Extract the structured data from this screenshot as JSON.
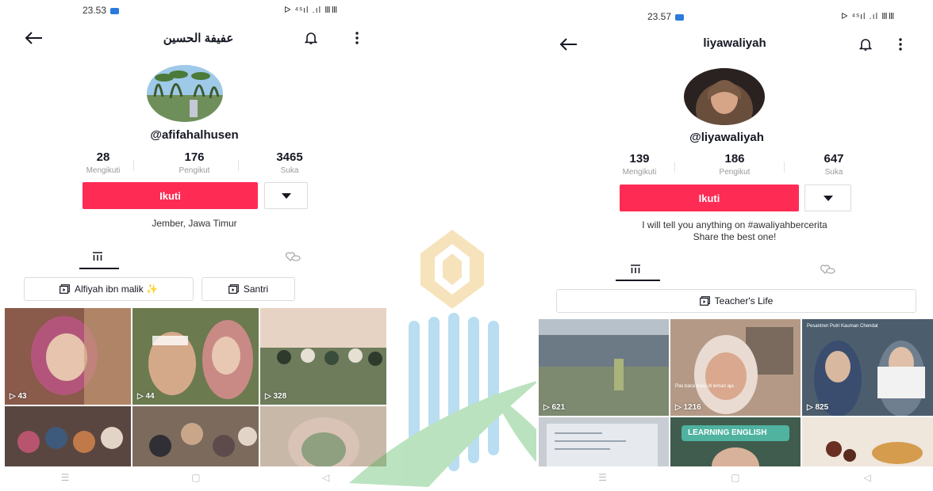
{
  "left": {
    "status_time": "23.53",
    "status_right": "ᐅ ⁴ˢıl .ıl ⅢⅢ",
    "title": "عفيفة الحسين",
    "handle": "@afifahalhusen",
    "stats": [
      {
        "num": "28",
        "label": "Mengikuti"
      },
      {
        "num": "176",
        "label": "Pengikut"
      },
      {
        "num": "3465",
        "label": "Suka"
      }
    ],
    "follow_label": "Ikuti",
    "bio": "Jember, Jawa Timur",
    "playlists": [
      {
        "label": "Alfiyah ibn malik ✨"
      },
      {
        "label": "Santri"
      }
    ],
    "tiles": [
      {
        "views": "▷ 43",
        "color": "#8a5a4a"
      },
      {
        "views": "▷ 44",
        "color": "#6c7a4f"
      },
      {
        "views": "▷ 328",
        "color": "#b8a27a"
      },
      {
        "views": "",
        "color": "#5a4640"
      },
      {
        "views": "",
        "color": "#7c6b5d"
      },
      {
        "views": "",
        "color": "#c8b8a8"
      }
    ]
  },
  "right": {
    "status_time": "23.57",
    "status_right": "ᐅ ⁴ˢıl .ıl ⅢⅢ",
    "title": "liyawaliyah",
    "handle": "@liyawaliyah",
    "stats": [
      {
        "num": "139",
        "label": "Mengikuti"
      },
      {
        "num": "186",
        "label": "Pengikut"
      },
      {
        "num": "647",
        "label": "Suka"
      }
    ],
    "follow_label": "Ikuti",
    "bio_line1": "I will tell you anything on #awaliyahbercerita",
    "bio_line2": "Share the best one!",
    "playlist": "Teacher's Life",
    "tiles": [
      {
        "views": "▷ 621",
        "color": "#8e9aa2"
      },
      {
        "views": "▷ 1216",
        "color": "#b49a86"
      },
      {
        "views": "▷ 825",
        "color": "#4c5e6e"
      },
      {
        "views": "",
        "color": "#c7cdd3"
      },
      {
        "views": "",
        "color": "#3f5c4e"
      },
      {
        "views": "",
        "color": "#d9c6a8"
      }
    ],
    "tile2_caption": "Pas baca buku di lemari aja",
    "tile3_caption": "Pesantren Putri Kauman Chendat",
    "tile5_label": "LEARNING ENGLISH"
  },
  "colors": {
    "accent": "#fe2c55",
    "watermark": "#3aa0d8",
    "watermark_gold": "#e8b040",
    "watermark_green": "#3cae4a"
  }
}
